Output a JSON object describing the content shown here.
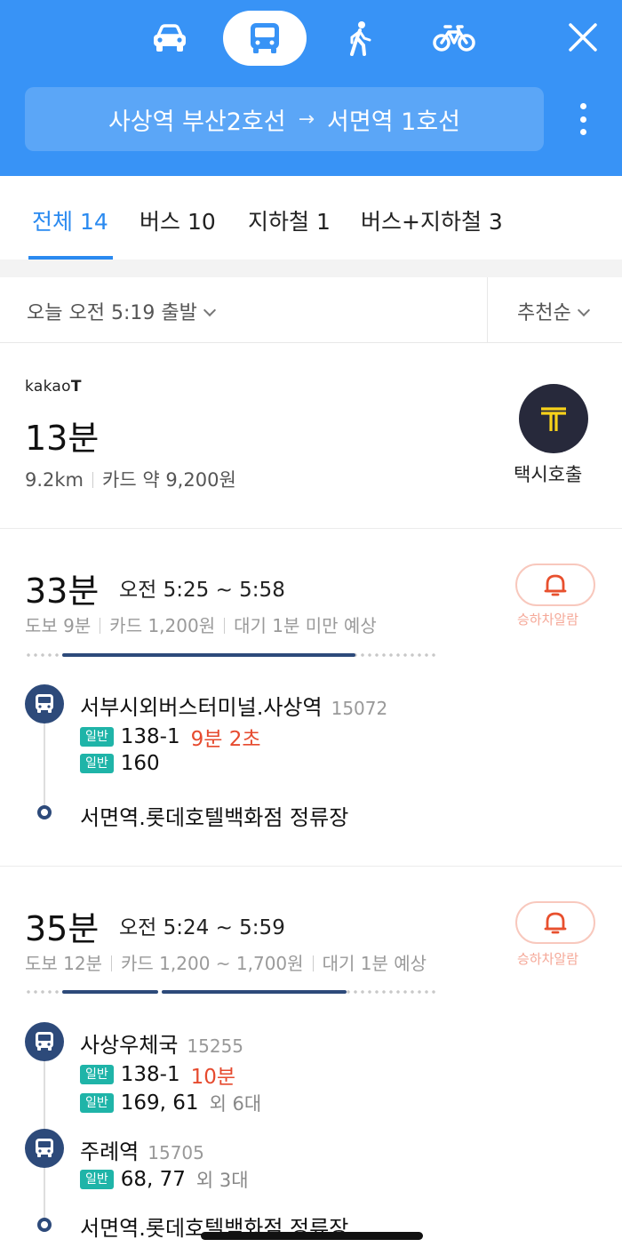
{
  "header": {
    "modes": [
      {
        "name": "car",
        "icon": "car-icon"
      },
      {
        "name": "bus",
        "icon": "bus-icon",
        "selected": true
      },
      {
        "name": "walk",
        "icon": "walk-icon"
      },
      {
        "name": "bike",
        "icon": "bike-icon"
      }
    ],
    "origin": "사상역 부산2호선",
    "arrow": "→",
    "destination": "서면역 1호선",
    "accent_color": "#3893f6"
  },
  "tabs": [
    {
      "label": "전체 14",
      "selected": true
    },
    {
      "label": "버스 10"
    },
    {
      "label": "지하철 1"
    },
    {
      "label": "버스+지하철 3"
    }
  ],
  "filter": {
    "departure": "오늘 오전 5:19 출발",
    "sort": "추천순"
  },
  "taxi": {
    "logo": "kakao",
    "logo_t": "T",
    "time": "13분",
    "distance": "9.2km",
    "fare": "카드 약 9,200원",
    "call_label": "택시호출"
  },
  "routes": [
    {
      "total": "33분",
      "range": "오전 5:25 ~ 5:58",
      "walk": "도보 9분",
      "fare": "카드 1,200원",
      "wait": "대기 1분 미만 예상",
      "alarm_label": "승하차알람",
      "stops": [
        {
          "name": "서부시외버스터미널.사상역",
          "id": "15072",
          "lines": [
            {
              "badge": "일반",
              "number": "138-1",
              "eta": "9분 2초"
            },
            {
              "badge": "일반",
              "number": "160"
            }
          ]
        }
      ],
      "end": "서면역.롯데호텔백화점 정류장"
    },
    {
      "total": "35분",
      "range": "오전 5:24 ~ 5:59",
      "walk": "도보 12분",
      "fare": "카드 1,200 ~ 1,700원",
      "wait": "대기 1분 예상",
      "alarm_label": "승하차알람",
      "stops": [
        {
          "name": "사상우체국",
          "id": "15255",
          "lines": [
            {
              "badge": "일반",
              "number": "138-1",
              "eta": "10분"
            },
            {
              "badge": "일반",
              "number": "169, 61",
              "extra": "외 6대"
            }
          ]
        },
        {
          "name": "주례역",
          "id": "15705",
          "lines": [
            {
              "badge": "일반",
              "number": "68, 77",
              "extra": "외 3대"
            }
          ]
        }
      ],
      "end": "서면역.롯데호텔백화점 정류장"
    }
  ]
}
